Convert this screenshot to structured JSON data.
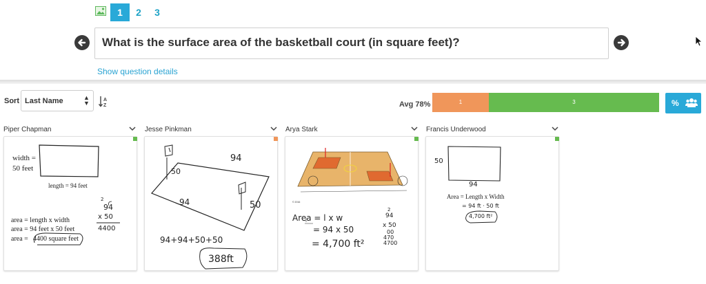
{
  "question_nav": {
    "image_icon": "image-icon",
    "tabs": [
      "1",
      "2",
      "3"
    ],
    "active_tab": "1",
    "question_text": "What is the surface area of the basketball court (in square feet)?",
    "details_link": "Show question details",
    "prev_icon": "arrow-left-circle-icon",
    "next_icon": "arrow-right-circle-icon"
  },
  "toolbar": {
    "sort_label": "Sort",
    "sort_value": "Last Name",
    "sort_icon": "sort-alpha-icon",
    "avg_label": "Avg 78%",
    "distribution": [
      {
        "count": "1",
        "color": "#f0965a"
      },
      {
        "count": "3",
        "color": "#66bb4f"
      }
    ],
    "percent_button": "%",
    "group_icon": "users-icon"
  },
  "students": [
    {
      "name": "Piper Chapman",
      "status_color": "#66bb4f",
      "work": {
        "width_label": "width =",
        "width_value": "50 feet",
        "length_label": "length = 94 feet",
        "line1": "area = length x width",
        "line2": "area = 94 feet x 50 feet",
        "line3_prefix": "area =",
        "answer": "4400 square feet",
        "calc_top": "94",
        "calc_mult": "x 50",
        "calc_result": "4400",
        "carry": "2"
      }
    },
    {
      "name": "Jesse Pinkman",
      "status_color": "#f0965a",
      "work": {
        "side_top": "94",
        "side_left": "50",
        "side_bottom": "94",
        "side_right": "50",
        "equation": "94+94+50+50",
        "answer": "388ft"
      }
    },
    {
      "name": "Arya Stark",
      "status_color": "#66bb4f",
      "work": {
        "line1": "Area = l x w",
        "line2": "= 94 x 50",
        "line3": "= 4,700 ft²",
        "calc_carry": "2",
        "calc_top": "94",
        "calc_mult": "x 50",
        "calc_sub": "00",
        "calc_sub2": "470",
        "calc_result": "4700"
      }
    },
    {
      "name": "Francis Underwood",
      "status_color": "#66bb4f",
      "work": {
        "side_left": "50",
        "side_bottom": "94",
        "line1": "Area = Length x Width",
        "line2": "= 94 ft · 50 ft",
        "answer": "4,700 ft²"
      }
    }
  ]
}
